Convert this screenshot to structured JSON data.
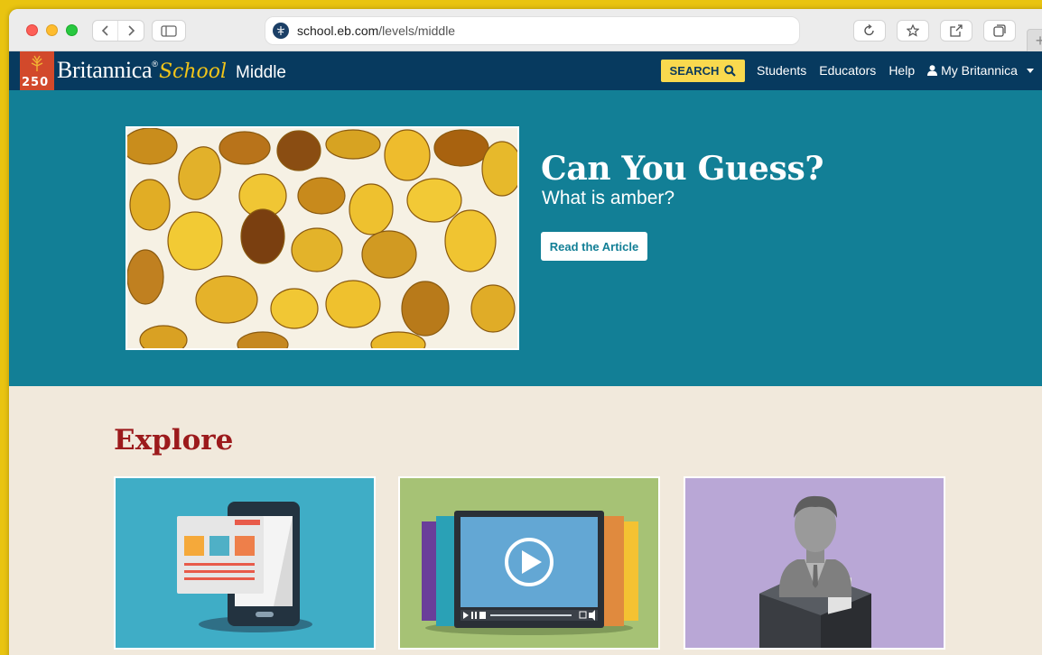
{
  "browser": {
    "url_domain": "school.eb.com",
    "url_path": "/levels/middle"
  },
  "site": {
    "logo_number": "250",
    "brand_name": "Britannica",
    "brand_reg": "®",
    "brand_school": "School",
    "level": "Middle",
    "search_label": "SEARCH",
    "nav": [
      "Students",
      "Educators",
      "Help"
    ],
    "account_label": "My Britannica"
  },
  "hero": {
    "title": "Can You Guess?",
    "subtitle": "What is amber?",
    "button_label": "Read the Article"
  },
  "explore": {
    "title": "Explore",
    "cards": [
      {
        "icon": "mobile-articles-icon"
      },
      {
        "icon": "video-player-icon"
      },
      {
        "icon": "biography-bust-icon"
      }
    ]
  },
  "colors": {
    "header": "#073a5f",
    "hero": "#127f96",
    "search": "#f9d94e",
    "explore_bg": "#f1e9dc",
    "explore_title": "#9c1a1c"
  }
}
